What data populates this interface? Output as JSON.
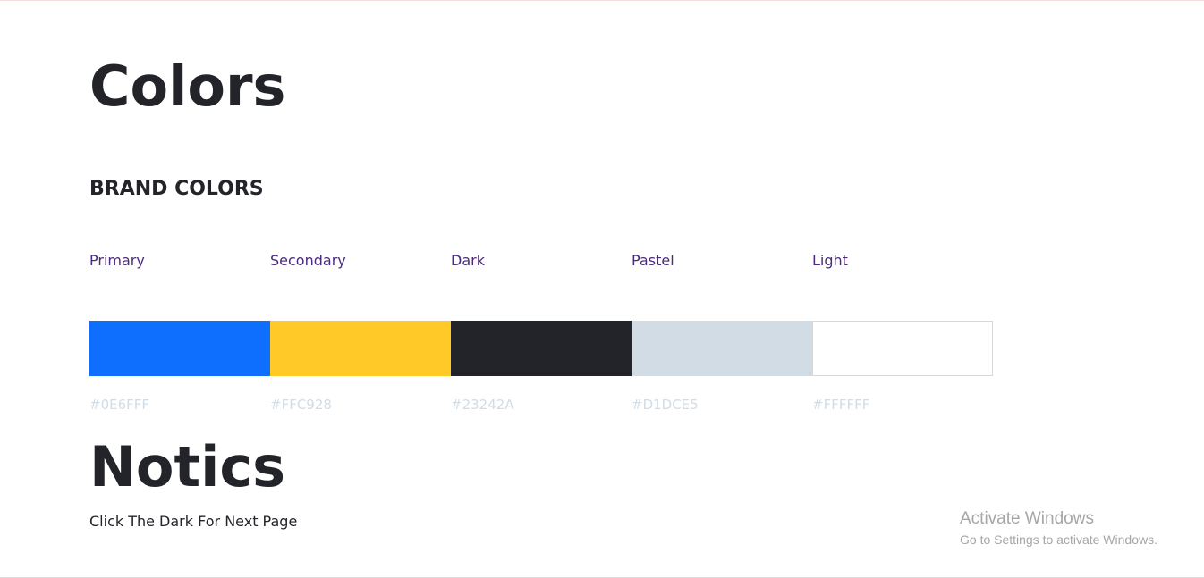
{
  "page": {
    "title": "Colors"
  },
  "brand": {
    "section_title": "BRAND COLORS",
    "colors": [
      {
        "name": "Primary",
        "hex": "#0E6FFF",
        "color": "#0E6FFF"
      },
      {
        "name": "Secondary",
        "hex": "#FFC928",
        "color": "#FFC928"
      },
      {
        "name": "Dark",
        "hex": "#23242A",
        "color": "#23242A"
      },
      {
        "name": "Pastel",
        "hex": "#D1DCE5",
        "color": "#D1DCE5"
      },
      {
        "name": "Light",
        "hex": "#FFFFFF",
        "color": "#FFFFFF"
      }
    ]
  },
  "notice": {
    "title": "Notics",
    "text": "Click The Dark For Next Page"
  },
  "watermark": {
    "title": "Activate Windows",
    "subtitle": "Go to Settings to activate Windows."
  }
}
